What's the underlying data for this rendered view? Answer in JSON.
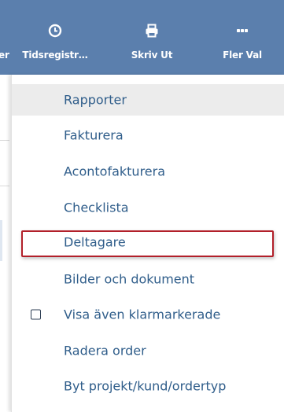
{
  "toolbar": {
    "cut_label": "er",
    "tidsregistrering_label": "Tidsregistr…",
    "print_label": "Skriv Ut",
    "more_label": "Fler Val"
  },
  "menu": {
    "items": [
      {
        "label": "Rapporter"
      },
      {
        "label": "Fakturera"
      },
      {
        "label": "Acontofakturera"
      },
      {
        "label": "Checklista"
      },
      {
        "label": "Deltagare"
      },
      {
        "label": "Bilder och dokument"
      },
      {
        "label": "Visa även klarmarkerade",
        "checkbox": true,
        "checked": false
      },
      {
        "label": "Radera order"
      },
      {
        "label": "Byt projekt/kund/ordertyp"
      }
    ],
    "hovered_item": "Rapporter",
    "highlighted_item": "Deltagare"
  },
  "colors": {
    "toolbar_bg": "#5b7fad",
    "menu_text": "#2f5d8a",
    "highlight_border": "#b2202a"
  }
}
